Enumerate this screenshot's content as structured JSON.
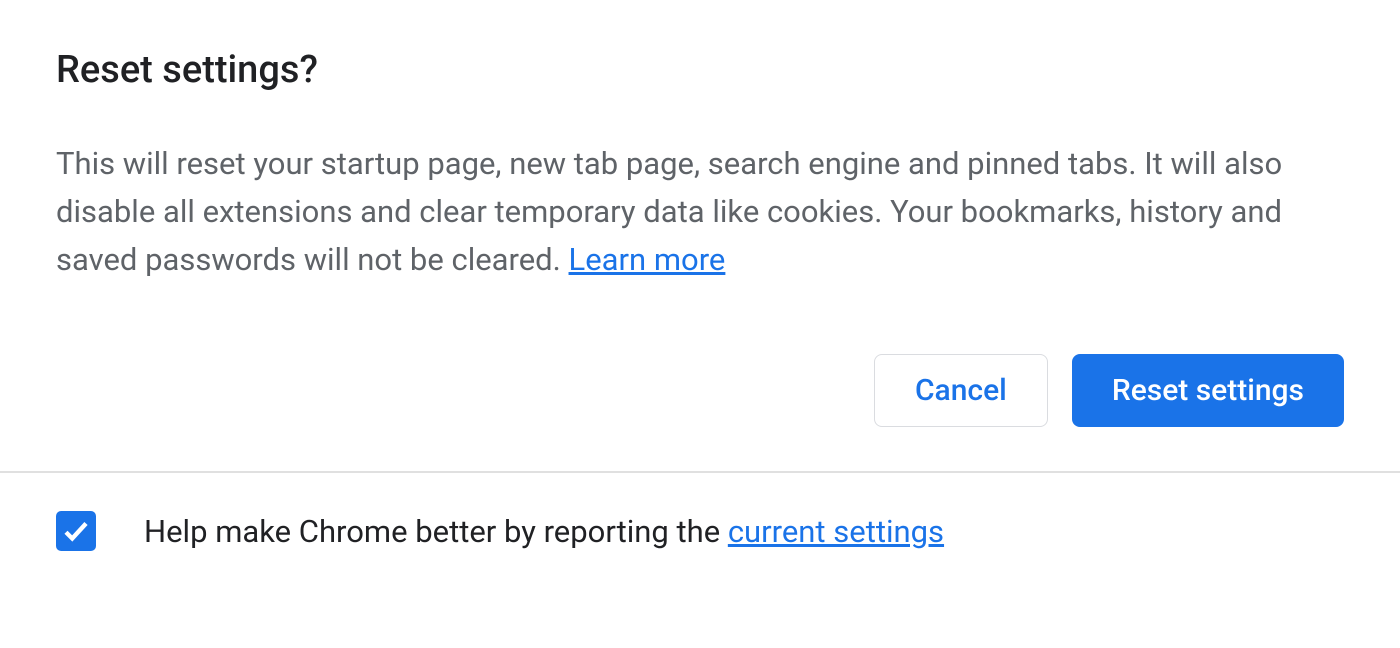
{
  "dialog": {
    "title": "Reset settings?",
    "body_text": "This will reset your startup page, new tab page, search engine and pinned tabs. It will also disable all extensions and clear temporary data like cookies. Your bookmarks, history and saved passwords will not be cleared. ",
    "learn_more_label": "Learn more",
    "cancel_label": "Cancel",
    "confirm_label": "Reset settings"
  },
  "footer": {
    "checkbox_checked": true,
    "text_prefix": "Help make Chrome better by reporting the ",
    "link_label": "current settings"
  }
}
